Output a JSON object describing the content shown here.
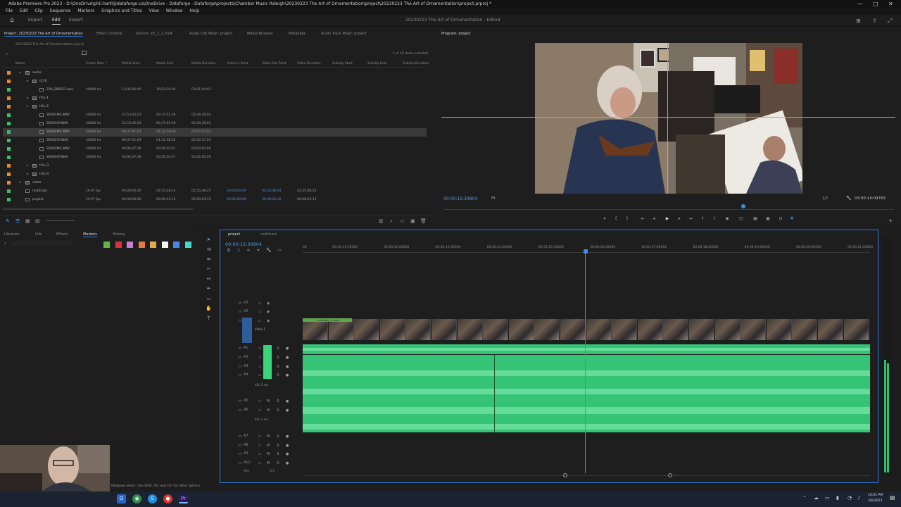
{
  "window": {
    "title": "Adobe Premiere Pro 2023 - D:\\OneDrive\\phil.hartl@dataforge.ca\\OneDrive - Dataforge - Dataforge\\projects\\Chamber Music Raleigh\\20230223 The Art of Ornamentation\\project\\20230223 The Art of Ornamentation\\project.prproj *",
    "controls": [
      "—",
      "□",
      "✕"
    ]
  },
  "menu": [
    "File",
    "Edit",
    "Clip",
    "Sequence",
    "Markers",
    "Graphics and Titles",
    "View",
    "Window",
    "Help"
  ],
  "workspace": {
    "tabs": [
      "Import",
      "Edit",
      "Export"
    ],
    "active": "Edit",
    "project_title": "20230223 The Art of Ornamentation - Edited"
  },
  "project_panel": {
    "tabs": [
      "Project: 20230223 The Art of Ornamentation",
      "Effect Controls",
      "Source: vlc_2_1.mp4",
      "Audio Clip Mixer: project",
      "Media Browser",
      "Metadata",
      "Audio Track Mixer: project"
    ],
    "path": "20230223 The Art of Ornamentation.prproj",
    "items_selected": "1 of 16 items selected",
    "columns": [
      "Name",
      "Frame Rate ^",
      "Media Start",
      "Media End",
      "Media Duration",
      "Video In Point",
      "Video Out Point",
      "Video Duration",
      "Subclip Start",
      "Subclip End",
      "Subclip Duration"
    ],
    "rows": [
      {
        "name": "audio",
        "color": "#f08a22",
        "indent": 1,
        "kind": "bin",
        "rate": "",
        "start": "",
        "end": "",
        "dur": "",
        "vin": "",
        "vout": "",
        "vdur": ""
      },
      {
        "name": "dr10",
        "color": "#f08a22",
        "indent": 2,
        "kind": "bin",
        "rate": "",
        "start": "",
        "end": "",
        "dur": "",
        "vin": "",
        "vout": "",
        "vdur": ""
      },
      {
        "name": "230_280223.wav",
        "color": "#39c26a",
        "indent": 3,
        "kind": "clip",
        "rate": "48000 Hz",
        "start": "13;06;56;00",
        "end": "16;02;20;04",
        "dur": "03;01;44;03",
        "vin": "",
        "vout": "",
        "vdur": ""
      },
      {
        "name": "h5n-1",
        "color": "#f08a22",
        "indent": 2,
        "kind": "bin",
        "rate": "",
        "start": "",
        "end": "",
        "dur": "",
        "vin": "",
        "vout": "",
        "vdur": ""
      },
      {
        "name": "h5n-2",
        "color": "#f08a22",
        "indent": 2,
        "kind": "bin",
        "rate": "",
        "start": "",
        "end": "",
        "dur": "",
        "vin": "",
        "vout": "",
        "vdur": ""
      },
      {
        "name": "SR001MS.WAV",
        "color": "#39c26a",
        "indent": 3,
        "kind": "clip",
        "rate": "48000 Hz",
        "start": "22;53;45;03",
        "end": "00;37;01;06",
        "dur": "02;04;16;03",
        "vin": "",
        "vout": "",
        "vdur": ""
      },
      {
        "name": "SR001XY.WAV",
        "color": "#39c26a",
        "indent": 3,
        "kind": "clip",
        "rate": "48000 Hz",
        "start": "22;53;45;03",
        "end": "00;37;01;06",
        "dur": "02;04;16;03",
        "vin": "",
        "vout": "",
        "vdur": ""
      },
      {
        "name": "SR002MS.WAV",
        "color": "#39c26a",
        "indent": 3,
        "kind": "clip",
        "rate": "48000 Hz",
        "start": "00;37;01;03",
        "end": "01;32;58;00",
        "dur": "00;55;57;03",
        "vin": "",
        "vout": "",
        "vdur": "",
        "selected": true
      },
      {
        "name": "SR002XY.WAV",
        "color": "#39c26a",
        "indent": 3,
        "kind": "clip",
        "rate": "48000 Hz",
        "start": "00;37;01;03",
        "end": "01;32;58;02",
        "dur": "00;55;57;03",
        "vin": "",
        "vout": "",
        "vdur": ""
      },
      {
        "name": "SR003MS.WAV",
        "color": "#39c26a",
        "indent": 3,
        "kind": "clip",
        "rate": "48000 Hz",
        "start": "00;06;47;28",
        "end": "00;56;50;07",
        "dur": "00;02;02;09",
        "vin": "",
        "vout": "",
        "vdur": ""
      },
      {
        "name": "SR003XY.WAV",
        "color": "#39c26a",
        "indent": 3,
        "kind": "clip",
        "rate": "48000 Hz",
        "start": "00;06;47;28",
        "end": "00;56;50;07",
        "dur": "00;02;02;09",
        "vin": "",
        "vout": "",
        "vdur": ""
      },
      {
        "name": "h5n-3",
        "color": "#f08a22",
        "indent": 2,
        "kind": "bin",
        "rate": "",
        "start": "",
        "end": "",
        "dur": "",
        "vin": "",
        "vout": "",
        "vdur": ""
      },
      {
        "name": "h5n-4",
        "color": "#f08a22",
        "indent": 2,
        "kind": "bin",
        "rate": "",
        "start": "",
        "end": "",
        "dur": "",
        "vin": "",
        "vout": "",
        "vdur": ""
      },
      {
        "name": "video",
        "color": "#f08a22",
        "indent": 1,
        "kind": "bin",
        "rate": "",
        "start": "",
        "end": "",
        "dur": "",
        "vin": "",
        "vout": "",
        "vdur": ""
      },
      {
        "name": "multicam",
        "color": "#39c26a",
        "indent": 1,
        "kind": "seq",
        "rate": "29.97 fps",
        "start": "00;00;00;00",
        "end": "02;55;48;24",
        "dur": "02;55;48;25",
        "vin": "00;00;00;00",
        "vout": "02;55;48;24",
        "vdur": "02;55;48;25"
      },
      {
        "name": "project",
        "color": "#39c26a",
        "indent": 1,
        "kind": "seq",
        "rate": "29.97 fps",
        "start": "00;00;00;00",
        "end": "00;00;03;12",
        "dur": "00;00;03;13",
        "vin": "00;00;00;00",
        "vout": "00;00;03;12",
        "vdur": "00;00;03;13"
      }
    ]
  },
  "program_monitor": {
    "tab": "Program: project",
    "timecode": "00:00:15:30804",
    "fit": "Fit",
    "quality": "1/2",
    "duration": "03:00:14:09763"
  },
  "left_lower_panel": {
    "tabs": [
      "Libraries",
      "Info",
      "Effects",
      "Markers",
      "History"
    ],
    "active": "Markers",
    "swatch_colors": [
      "#5fb54a",
      "#d8323c",
      "#c77dd0",
      "#e07a3e",
      "#e6a84a",
      "#f4f4f4",
      "#4a86e8",
      "#44d6c8"
    ]
  },
  "timeline": {
    "tabs": [
      "project",
      "multicam"
    ],
    "timecode": "00:00:15:30804",
    "ruler": [
      "00",
      "00:00:11:00000",
      "00:00:12:00000",
      "00:00:13:00000",
      "00:00:14:00000",
      "00:00:15:00000",
      "00:00:16:00000",
      "00:00:17:00000",
      "00:00:18:00000",
      "00:00:19:00000",
      "00:00:20:00000",
      "00:00:21:00000"
    ],
    "video_tracks": [
      "V3",
      "V2",
      "V1"
    ],
    "video1_name": "Video 1",
    "video_clip": "multicam_1.mp4",
    "audio_tracks": [
      "A1",
      "A2",
      "A3",
      "A4",
      "A5",
      "A6",
      "A7",
      "A8",
      "A9",
      "A10"
    ],
    "audio_track_names": {
      "A4": "h5n 2 ms",
      "A6": "h5n 3 ms"
    },
    "mix": "Mix",
    "mix_value": "0.0"
  },
  "status_bar": {
    "hint": "Marquee select. Use Shift, Alt, and Ctrl for other options."
  },
  "taskbar": {
    "time": "10:01 PM",
    "date": "3/6/2023"
  }
}
